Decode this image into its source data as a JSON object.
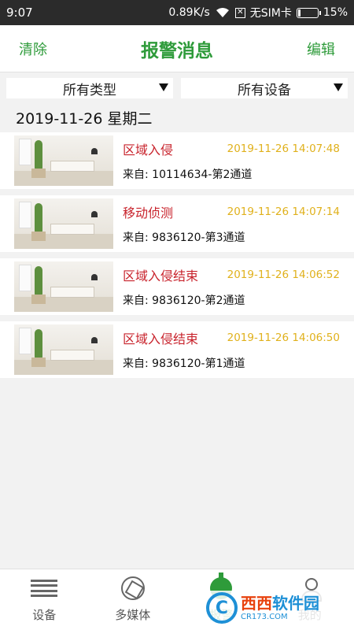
{
  "status": {
    "time": "9:07",
    "speed": "0.89K/s",
    "sim": "无SIM卡",
    "battery": "15%",
    "battery_level": 0.15
  },
  "header": {
    "left": "清除",
    "title": "报警消息",
    "right": "编辑"
  },
  "filters": [
    {
      "label": "所有类型"
    },
    {
      "label": "所有设备"
    }
  ],
  "date_header": "2019-11-26  星期二",
  "alarms": [
    {
      "type": "区域入侵",
      "time": "2019-11-26 14:07:48",
      "source": "来自: 10114634-第2通道"
    },
    {
      "type": "移动侦测",
      "time": "2019-11-26 14:07:14",
      "source": "来自: 9836120-第3通道"
    },
    {
      "type": "区域入侵结束",
      "time": "2019-11-26 14:06:52",
      "source": "来自: 9836120-第2通道"
    },
    {
      "type": "区域入侵结束",
      "time": "2019-11-26 14:06:50",
      "source": "来自: 9836120-第1通道"
    }
  ],
  "nav": [
    {
      "label": "设备",
      "icon": "list-icon"
    },
    {
      "label": "多媒体",
      "icon": "aperture-icon"
    },
    {
      "label": "报警",
      "icon": "alarm-icon"
    },
    {
      "label": "我的",
      "icon": "person-icon"
    }
  ],
  "watermark": {
    "logo": "C",
    "main_a": "西西",
    "main_b": "软件园",
    "sub": "CR173.COM"
  },
  "colors": {
    "accent": "#2e9b3a",
    "alarm_type": "#c8232c",
    "timestamp": "#e0b11c"
  }
}
